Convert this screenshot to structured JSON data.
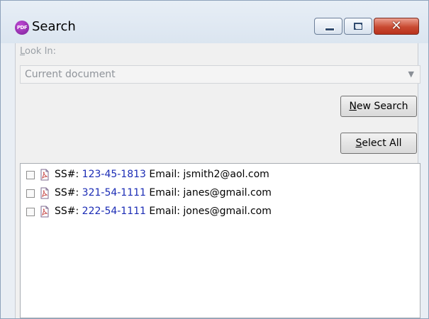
{
  "window": {
    "title": "Search",
    "icon": "pdf-app-icon",
    "icon_text": "PDF"
  },
  "controls": {
    "minimize": "minimize-icon",
    "maximize": "maximize-icon",
    "close": "close-icon",
    "close_glyph": "✕"
  },
  "lookin": {
    "label_first": "L",
    "label_rest": "ook In:",
    "value": "Current document",
    "arrow": "▼"
  },
  "buttons": {
    "new_search_acc": "N",
    "new_search_rest": "ew Search",
    "select_all_acc": "S",
    "select_all_rest": "elect All"
  },
  "results": [
    {
      "prefix": "SS#: ",
      "ssn": "123-45-1813",
      "suffix": " Email: jsmith2@aol.com"
    },
    {
      "prefix": "SS#: ",
      "ssn": "321-54-1111",
      "suffix": " Email: janes@gmail.com"
    },
    {
      "prefix": "SS#: ",
      "ssn": "222-54-1111",
      "suffix": " Email: jones@gmail.com"
    }
  ],
  "colors": {
    "ssn_text": "#1a2bb5",
    "close_button": "#c94a32",
    "app_icon": "#9b2fb8"
  }
}
